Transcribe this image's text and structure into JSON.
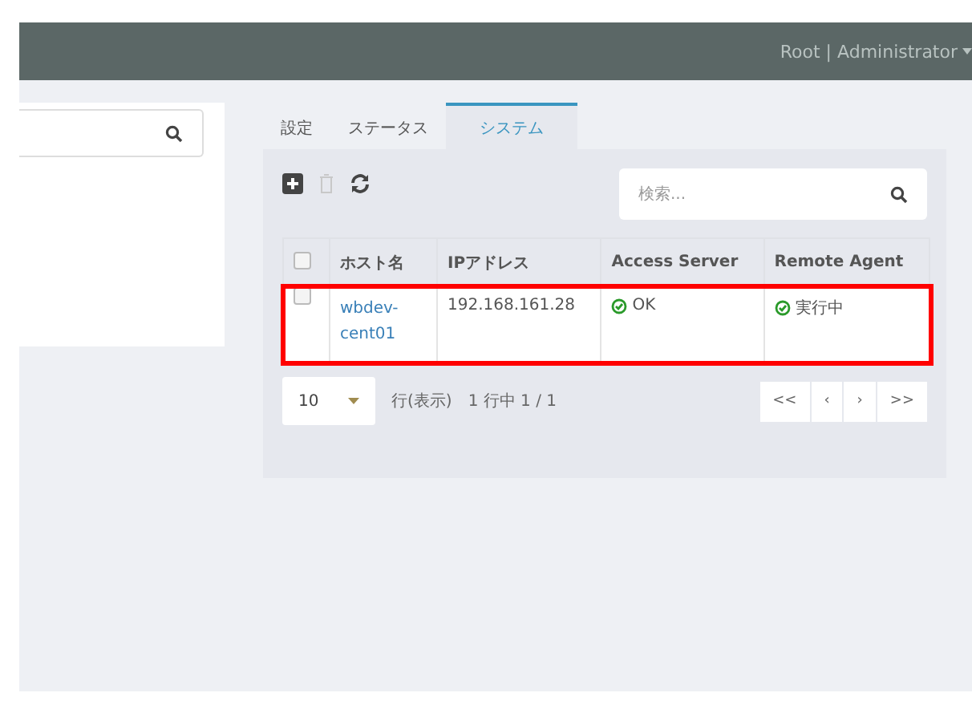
{
  "header": {
    "user": "Root | Administrator"
  },
  "tabs": [
    {
      "label": "設定",
      "selected": false
    },
    {
      "label": "ステータス",
      "selected": false
    },
    {
      "label": "システム",
      "selected": true
    }
  ],
  "search": {
    "placeholder": "検索..."
  },
  "table": {
    "all_checked": false,
    "columns": [
      "ホスト名",
      "IPアドレス",
      "Access Server",
      "Remote Agent"
    ],
    "rows": [
      {
        "checked": false,
        "highlighted": true,
        "host": "wbdev-cent01",
        "ip": "192.168.161.28",
        "access_server": "OK",
        "remote_agent": "実行中"
      }
    ]
  },
  "pagination": {
    "page_size": "10",
    "rows_label": "行(表示)",
    "summary": "1 行中 1 / 1",
    "buttons": [
      "<<",
      "‹",
      "›",
      ">>"
    ]
  }
}
